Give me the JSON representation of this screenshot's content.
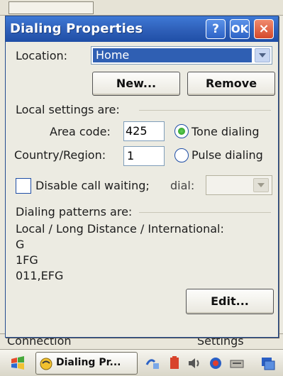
{
  "dialog": {
    "title": "Dialing Properties",
    "help_label": "?",
    "ok_label": "OK",
    "close_label": "×"
  },
  "location": {
    "label": "Location:",
    "selected": "Home"
  },
  "buttons": {
    "new": "New...",
    "remove": "Remove",
    "edit": "Edit..."
  },
  "local_settings": {
    "header": "Local settings are:",
    "area_code_label": "Area code:",
    "area_code": "425",
    "country_label": "Country/Region:",
    "country": "1",
    "tone_label": "Tone dialing",
    "pulse_label": "Pulse dialing",
    "tone_selected": true
  },
  "call_waiting": {
    "label": "Disable call waiting;",
    "dial_label": "dial:",
    "checked": false,
    "dial_value": ""
  },
  "patterns": {
    "header": "Dialing patterns are:",
    "types": "Local / Long Distance / International:",
    "values": [
      "G",
      "1FG",
      "011,EFG"
    ]
  },
  "background_menu": {
    "left": "Connection",
    "right": "Settings"
  },
  "taskbar": {
    "task_label": "Dialing Pr...",
    "start_icon": "windows-flag-icon",
    "tray_icons": [
      "network-icon",
      "power-icon",
      "speaker-icon",
      "sync-icon",
      "keyboard-icon",
      "tasks-icon"
    ]
  },
  "colors": {
    "title_bar": "#2e5fb8",
    "selection": "#2f5fb3",
    "close_button": "#d4492c",
    "radio_selected": "#21951a"
  }
}
